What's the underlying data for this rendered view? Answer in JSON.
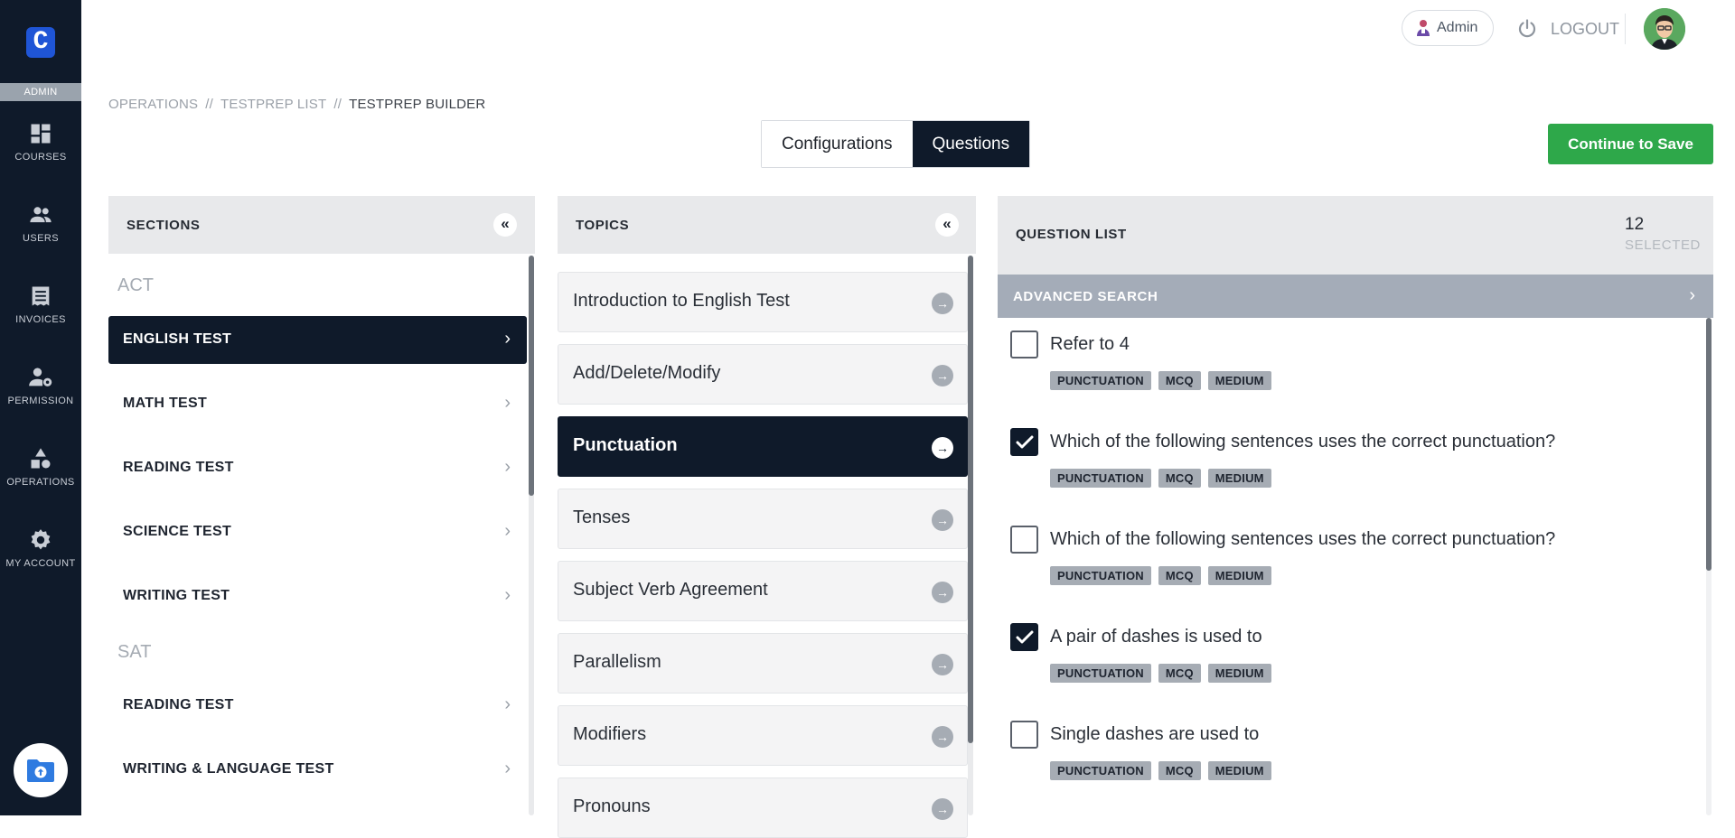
{
  "sidebar": {
    "logo_letter": "C",
    "role": "ADMIN",
    "items": [
      {
        "label": "COURSES",
        "icon": "dashboard-icon"
      },
      {
        "label": "USERS",
        "icon": "users-icon"
      },
      {
        "label": "INVOICES",
        "icon": "invoice-icon"
      },
      {
        "label": "PERMISSION",
        "icon": "user-gear-icon"
      },
      {
        "label": "OPERATIONS",
        "icon": "shapes-icon"
      },
      {
        "label": "MY ACCOUNT",
        "icon": "gear-icon"
      }
    ],
    "upload_icon": "folder-upload-icon"
  },
  "topbar": {
    "admin_label": "Admin",
    "logout_label": "LOGOUT"
  },
  "breadcrumb": [
    "OPERATIONS",
    "TESTPREP LIST",
    "TESTPREP BUILDER"
  ],
  "tabs": [
    {
      "label": "Configurations",
      "active": false
    },
    {
      "label": "Questions",
      "active": true
    }
  ],
  "save_label": "Continue to Save",
  "sections": {
    "title": "SECTIONS",
    "collapse_glyph": "«",
    "groups": [
      {
        "name": "ACT",
        "items": [
          "ENGLISH TEST",
          "MATH TEST",
          "READING TEST",
          "SCIENCE TEST",
          "WRITING TEST"
        ]
      },
      {
        "name": "SAT",
        "items": [
          "READING TEST",
          "WRITING & LANGUAGE TEST"
        ]
      }
    ],
    "active": "ENGLISH TEST"
  },
  "topics": {
    "title": "TOPICS",
    "collapse_glyph": "«",
    "items": [
      "Introduction to English Test",
      "Add/Delete/Modify",
      "Punctuation",
      "Tenses",
      "Subject Verb Agreement",
      "Parallelism",
      "Modifiers",
      "Pronouns"
    ],
    "active": "Punctuation"
  },
  "questions": {
    "title": "QUESTION LIST",
    "selected_count": "12",
    "selected_label": "SELECTED",
    "advanced_search": "ADVANCED SEARCH",
    "items": [
      {
        "text": "Refer to 4",
        "checked": false,
        "tags": [
          "PUNCTUATION",
          "MCQ",
          "MEDIUM"
        ]
      },
      {
        "text": "Which of the following sentences uses the correct punctuation?",
        "checked": true,
        "tags": [
          "PUNCTUATION",
          "MCQ",
          "MEDIUM"
        ]
      },
      {
        "text": "Which of the following sentences uses the correct punctuation?",
        "checked": false,
        "tags": [
          "PUNCTUATION",
          "MCQ",
          "MEDIUM"
        ]
      },
      {
        "text": "A pair of dashes is used to",
        "checked": true,
        "tags": [
          "PUNCTUATION",
          "MCQ",
          "MEDIUM"
        ]
      },
      {
        "text": "Single dashes are used to",
        "checked": false,
        "tags": [
          "PUNCTUATION",
          "MCQ",
          "MEDIUM"
        ]
      }
    ]
  },
  "colors": {
    "navy": "#0f1a2a",
    "save_green": "#2ea84a",
    "advanced_search_bg": "#a4acb8",
    "tag_bg": "#a6acb4"
  }
}
